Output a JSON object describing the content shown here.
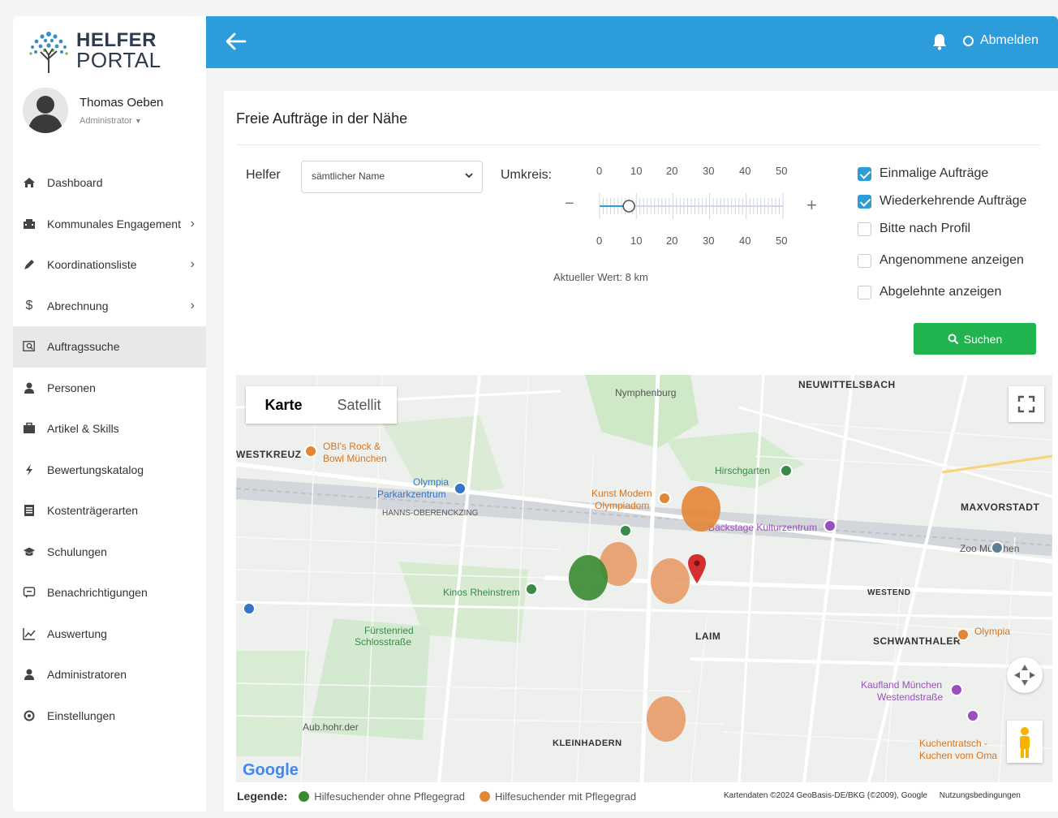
{
  "logo": {
    "line1": "HELFER",
    "line2": "PORTAL"
  },
  "user": {
    "name": "Thomas Oeben",
    "role": "Administrator"
  },
  "menu": [
    {
      "label": "Dashboard",
      "icon": "home-icon",
      "chev": ""
    },
    {
      "label": "Kommunales Engagement",
      "icon": "building-icon",
      "chev": "›"
    },
    {
      "label": "Koordinationsliste",
      "icon": "pen-icon",
      "chev": "›"
    },
    {
      "label": "Abrechnung",
      "icon": "dollar-icon",
      "chev": "›"
    },
    {
      "label": "Auftragssuche",
      "icon": "search-list-icon",
      "chev": ""
    },
    {
      "label": "Personen",
      "icon": "person-icon",
      "chev": ""
    },
    {
      "label": "Artikel & Skills",
      "icon": "briefcase-icon",
      "chev": ""
    },
    {
      "label": "Bewertungskatalog",
      "icon": "bolt-icon",
      "chev": ""
    },
    {
      "label": "Kostenträgerarten",
      "icon": "list-icon",
      "chev": ""
    },
    {
      "label": "Schulungen",
      "icon": "graduation-icon",
      "chev": ""
    },
    {
      "label": "Benachrichtigungen",
      "icon": "message-icon",
      "chev": ""
    },
    {
      "label": "Auswertung",
      "icon": "chart-icon",
      "chev": ""
    },
    {
      "label": "Administratoren",
      "icon": "admin-icon",
      "chev": ""
    },
    {
      "label": "Einstellungen",
      "icon": "gear-icon",
      "chev": ""
    }
  ],
  "topbar": {
    "logout": "Abmelden"
  },
  "panel": {
    "title": "Freie Aufträge in der Nähe",
    "helper_label": "Helfer",
    "helper_value": "sämtlicher Name",
    "radius_label": "Umkreis:",
    "scale": [
      "0",
      "10",
      "20",
      "30",
      "40",
      "50"
    ],
    "minus": "−",
    "plus": "+",
    "current_value": "Aktueller Wert: 8 km",
    "slider_value_km": 8,
    "checkboxes": [
      {
        "label": "Einmalige Aufträge",
        "checked": true
      },
      {
        "label": "Wiederkehrende Aufträge",
        "checked": true
      },
      {
        "label": "Bitte nach Profil",
        "checked": false
      },
      {
        "label": "Angenommene anzeigen",
        "checked": false
      },
      {
        "label": "Abgelehnte anzeigen",
        "checked": false
      }
    ],
    "search_button": "Suchen"
  },
  "map": {
    "tab_map": "Karte",
    "tab_satellite": "Satellit",
    "labels": {
      "nymphenburg": "Nymphenburg",
      "neuwittelsbach": "NEUWITTELSBACH",
      "westkreuz": "WESTKREUZ",
      "obis1": "OBI's Rock &",
      "obis2": "Bowl München",
      "olympia1": "Olympia",
      "olympia2": "Parkarkzentrum",
      "oberwiesenfeld": "HANNS-OBERENCKZING",
      "hirschgarten": "Hirschgarten",
      "kunst1": "Kunst Modern",
      "kunst2": "Olympiadom",
      "backstage": "Backstage Kulturzentrum",
      "maxvorstadt": "MAXVORSTADT",
      "zoo": "Zoo München",
      "kinos": "Kinos Rheinstrem",
      "laim": "LAIM",
      "westend": "WESTEND",
      "schwanthaler": "SCHWANTHALER",
      "olympia_gate": "Olympia",
      "kaufland1": "Kaufland München",
      "kaufland2": "Westendstraße",
      "fuerstenried1": "Fürstenried",
      "fuerstenried2": "Schlosstraße",
      "auhof": "Aub.hohr.der",
      "kleinhadern": "KLEINHADERN",
      "kuchen1": "Kuchentratsch -",
      "kuchen2": "Kuchen vom Oma",
      "google": "Google"
    },
    "colors": {
      "green": "#3a8a32",
      "orange": "#e38636",
      "pin": "#d32f2f"
    }
  },
  "legend": {
    "title": "Legende:",
    "green_label": "Hilfesuchender ohne Pflegegrad",
    "orange_label": "Hilfesuchender mit Pflegegrad",
    "attribution": "Kartendaten ©2024 GeoBasis-DE/BKG (©2009), Google",
    "terms": "Nutzungsbedingungen"
  }
}
